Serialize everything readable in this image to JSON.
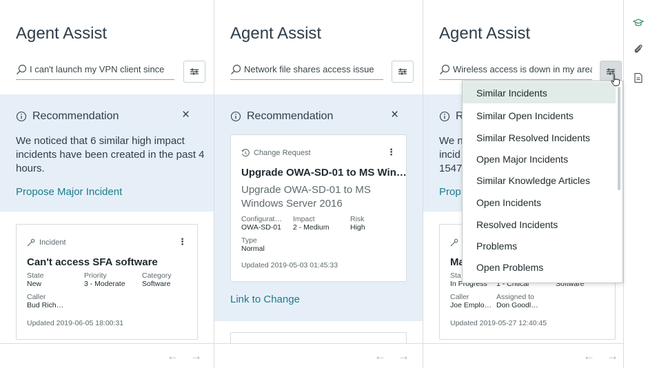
{
  "panels": [
    {
      "title": "Agent Assist",
      "search_value": "I can't launch my VPN client since",
      "recommendation": {
        "label": "Recommendation",
        "text": "We noticed that 6 similar high impact incidents have been created in the past 4 hours.",
        "link": "Propose Major Incident"
      },
      "card": {
        "type": "Incident",
        "title": "Can't access SFA software",
        "fields": [
          {
            "label": "State",
            "value": "New"
          },
          {
            "label": "Priority",
            "value": "3 - Moderate"
          },
          {
            "label": "Category",
            "value": "Software"
          },
          {
            "label": "Caller",
            "value": "Bud Rich…"
          }
        ],
        "updated": "Updated 2019-06-05 18:00:31"
      },
      "nav": {
        "prev": "←",
        "next": "→"
      }
    },
    {
      "title": "Agent Assist",
      "search_value": "Network file shares access issue",
      "recommendation": {
        "label": "Recommendation",
        "link": "Link to Change"
      },
      "card": {
        "type": "Change Request",
        "title": "Upgrade OWA-SD-01 to MS Win…",
        "subtitle": "Upgrade OWA-SD-01 to MS Windows Server 2016",
        "fields": [
          {
            "label": "Configurat…",
            "value": "OWA-SD-01"
          },
          {
            "label": "Impact",
            "value": "2 - Medium"
          },
          {
            "label": "Risk",
            "value": "High"
          },
          {
            "label": "Type",
            "value": "Normal"
          }
        ],
        "updated": "Updated 2019-05-03 01:45:33"
      },
      "nav": {
        "prev": "←",
        "next": "→"
      }
    },
    {
      "title": "Agent Assist",
      "search_value": "Wireless access is down in my area",
      "recommendation": {
        "label_partial": "R",
        "text_partial": [
          "We n",
          "incid",
          "1547"
        ],
        "link_partial": "Prop"
      },
      "card": {
        "title_partial": "Ma",
        "fields": [
          {
            "label": "Sta",
            "value": "In Progress"
          },
          {
            "label": "",
            "value": "1 - Critical"
          },
          {
            "label": "",
            "value": "Software"
          },
          {
            "label": "Caller",
            "value": "Joe Emplo…"
          },
          {
            "label": "Assigned to",
            "value": "Don Goodl…"
          }
        ],
        "updated": "Updated 2019-05-27 12:40:45"
      },
      "nav": {
        "prev": "←",
        "next": "→"
      }
    }
  ],
  "close_symbol": "×",
  "kebab_symbol": "⋮",
  "dropdown": {
    "items": [
      "Similar Incidents",
      "Similar Open Incidents",
      "Similar Resolved Incidents",
      "Open Major Incidents",
      "Similar Knowledge Articles",
      "Open Incidents",
      "Resolved Incidents",
      "Problems",
      "Open Problems"
    ],
    "highlighted_index": 0
  },
  "sidebar_icons": [
    "graduation-cap-icon",
    "paperclip-icon",
    "document-icon"
  ],
  "colors": {
    "accent": "#1b7b8c",
    "band": "#e6eff8",
    "highlight": "#e1ebe8"
  }
}
